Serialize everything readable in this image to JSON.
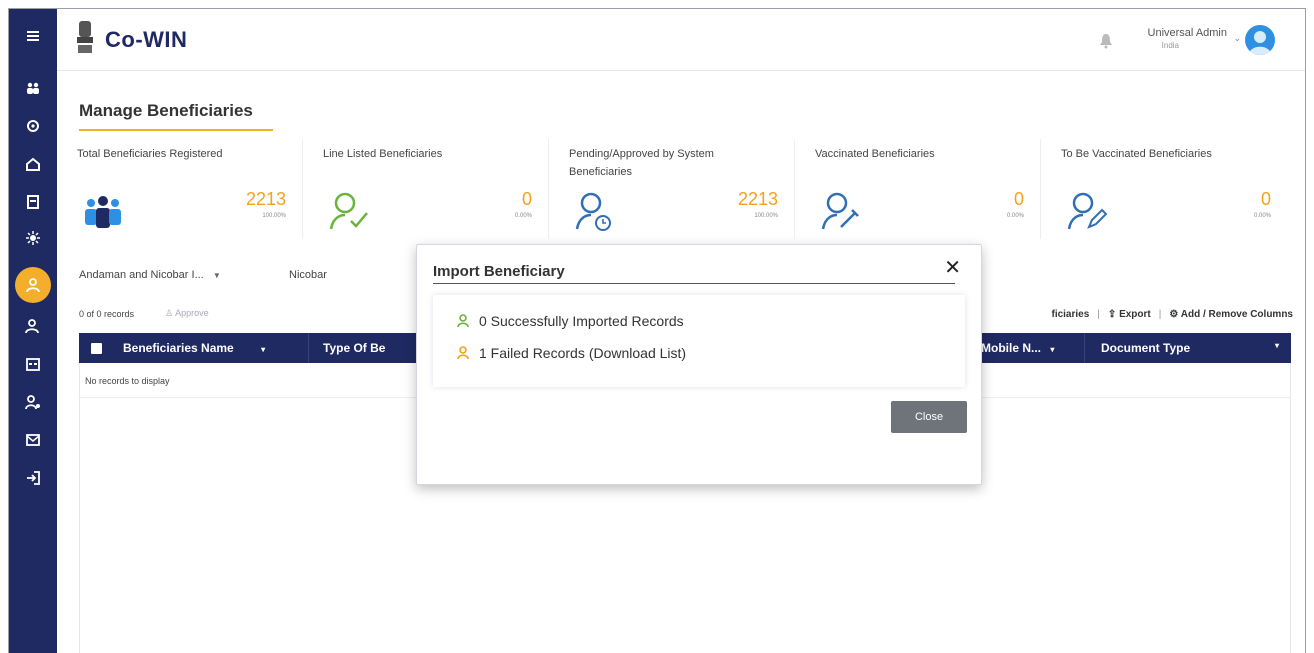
{
  "app": {
    "name": "Co-WIN"
  },
  "header": {
    "user_name": "Universal Admin",
    "user_sub": "India"
  },
  "page": {
    "title": "Manage Beneficiaries"
  },
  "cards": [
    {
      "title": "Total Beneficiaries Registered",
      "value": "2213",
      "pct": "100.00%",
      "icon": "people-group-icon"
    },
    {
      "title": "Line Listed Beneficiaries",
      "value": "0",
      "pct": "0.00%",
      "icon": "user-check-icon"
    },
    {
      "title": "Pending/Approved by System Beneficiaries",
      "value": "2213",
      "pct": "100.00%",
      "icon": "user-clock-icon"
    },
    {
      "title": "Vaccinated Beneficiaries",
      "value": "0",
      "pct": "0.00%",
      "icon": "user-syringe-icon"
    },
    {
      "title": "To Be Vaccinated Beneficiaries",
      "value": "0",
      "pct": "0.00%",
      "icon": "user-edit-icon"
    }
  ],
  "filters": {
    "state": "Andaman and Nicobar I...",
    "district": "Nicobar"
  },
  "records": {
    "count_text": "0 of 0 records",
    "approve": "Approve"
  },
  "toolbar": {
    "beneficiaries": "ficiaries",
    "export": "Export",
    "add_remove_columns": "Add / Remove Columns"
  },
  "grid": {
    "columns": [
      "Beneficiaries Name",
      "Type Of Be",
      "Mobile N...",
      "Document Type"
    ],
    "empty_text": "No records to display"
  },
  "modal": {
    "title": "Import Beneficiary",
    "success_text": "0 Successfully Imported Records",
    "failed_text": "1 Failed Records",
    "download_text": "(Download List)",
    "close_label": "Close"
  },
  "colors": {
    "navy": "#1f2a63",
    "accent": "#f3ae2b",
    "success": "#6bb33c",
    "warning": "#f3a21e",
    "icon_blue": "#2f6fb5"
  }
}
